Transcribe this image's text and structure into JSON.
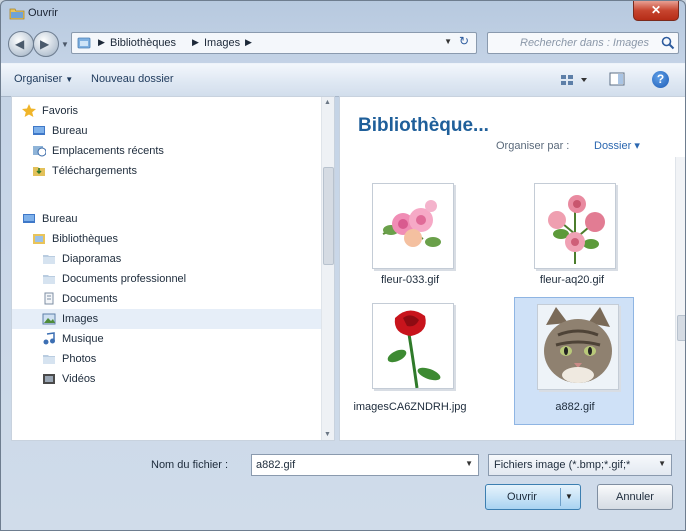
{
  "window": {
    "title": "Ouvrir",
    "close_glyph": "✕"
  },
  "address": {
    "crumbs": [
      "Bibliothèques",
      "Images"
    ],
    "search_placeholder": "Rechercher dans : Images"
  },
  "toolbar": {
    "organize": "Organiser",
    "new_folder": "Nouveau dossier"
  },
  "nav": {
    "items": [
      {
        "label": "Favoris",
        "icon": "star-icon"
      },
      {
        "label": "Bureau",
        "icon": "desktop-icon"
      },
      {
        "label": "Emplacements récents",
        "icon": "recent-places-icon"
      },
      {
        "label": "Téléchargements",
        "icon": "downloads-icon"
      },
      {
        "label": "Bureau",
        "icon": "desktop-icon"
      },
      {
        "label": "Bibliothèques",
        "icon": "libraries-icon"
      },
      {
        "label": "Diaporamas",
        "icon": "folder-icon"
      },
      {
        "label": "Documents professionnel",
        "icon": "folder-icon"
      },
      {
        "label": "Documents",
        "icon": "documents-icon"
      },
      {
        "label": "Images",
        "icon": "pictures-icon",
        "selected": true
      },
      {
        "label": "Musique",
        "icon": "music-icon"
      },
      {
        "label": "Photos",
        "icon": "folder-icon"
      },
      {
        "label": "Vidéos",
        "icon": "videos-icon"
      }
    ]
  },
  "content": {
    "library_title": "Bibliothèque...",
    "arrange_label": "Organiser par :",
    "arrange_value": "Dossier",
    "files": [
      {
        "name": "fleur-033.gif",
        "thumb": "pink-roses"
      },
      {
        "name": "fleur-aq20.gif",
        "thumb": "rose-bouquet"
      },
      {
        "name": "imagesCA6ZNDRH.jpg",
        "thumb": "red-rose"
      },
      {
        "name": "a882.gif",
        "thumb": "cat",
        "selected": true
      }
    ]
  },
  "footer": {
    "filename_label": "Nom du fichier :",
    "filename_value": "a882.gif",
    "filter_value": "Fichiers image (*.bmp;*.gif;*",
    "open_label": "Ouvrir",
    "cancel_label": "Annuler"
  },
  "colors": {
    "accent": "#1f5f9a",
    "selection": "#cfe1f7",
    "close": "#c7452f"
  }
}
